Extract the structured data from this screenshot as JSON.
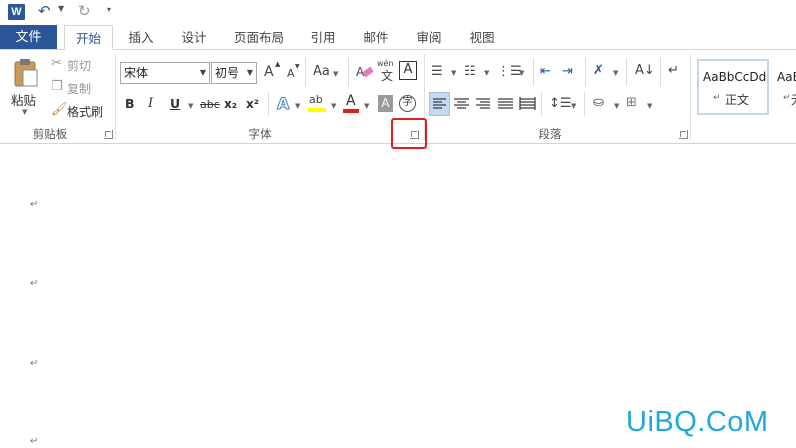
{
  "quick_access": {
    "app_icon": "W",
    "undo_icon": "undo-icon",
    "redo_icon": "redo-icon",
    "customize_icon": "qat-customize-icon"
  },
  "tabs": {
    "file": "文件",
    "home": "开始",
    "insert": "插入",
    "design": "设计",
    "layout": "页面布局",
    "references": "引用",
    "mailings": "邮件",
    "review": "审阅",
    "view": "视图"
  },
  "clipboard": {
    "paste": "粘贴",
    "cut": "剪切",
    "copy": "复制",
    "format_painter": "格式刷",
    "group_label": "剪贴板"
  },
  "font": {
    "font_name": "宋体",
    "font_size": "初号",
    "case_button": "Aa",
    "phonetic_label": "wén",
    "phonetic_char": "文",
    "border_char": "A",
    "bold": "B",
    "italic": "I",
    "underline": "U",
    "strikethrough": "abc",
    "subscript": "x₂",
    "superscript": "x²",
    "text_effect": "A",
    "highlight": "ab",
    "font_color": "A",
    "char_shading": "A",
    "enclose_char": "字",
    "grow": "A",
    "shrink": "A",
    "group_label": "字体"
  },
  "paragraph": {
    "group_label": "段落"
  },
  "styles": {
    "sample1": "AaBbCcDd",
    "name1": "正文",
    "sample2": "AaB",
    "name2": "无"
  },
  "colors": {
    "accent": "#2b579a",
    "highlight_yellow": "#ffff00",
    "font_red": "#e02020",
    "annotation_red": "#e02020",
    "watermark": "#1ea9d9"
  },
  "document": {
    "paragraph_mark": "↵"
  },
  "watermark": "UiBQ.CoM"
}
